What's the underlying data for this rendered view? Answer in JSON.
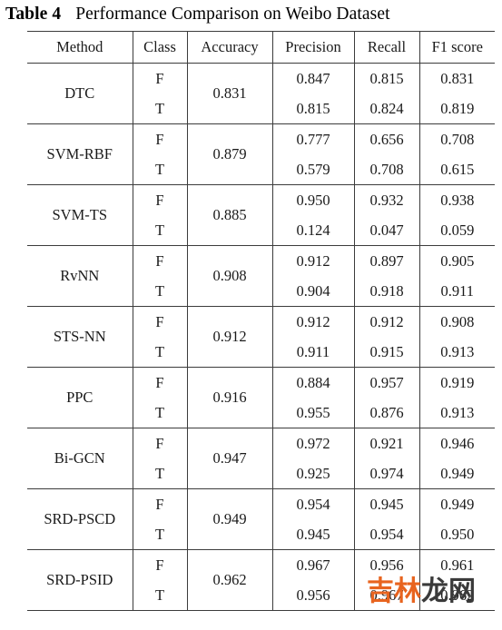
{
  "caption": {
    "label": "Table 4",
    "text": "Performance Comparison on Weibo Dataset"
  },
  "table": {
    "headers": [
      "Method",
      "Class",
      "Accuracy",
      "Precision",
      "Recall",
      "F1 score"
    ],
    "class_labels": {
      "f": "F",
      "t": "T"
    },
    "rows": [
      {
        "method": "DTC",
        "method_bold": false,
        "accuracy": "0.831",
        "accuracy_bold": false,
        "f": {
          "precision": "0.847",
          "recall": "0.815",
          "f1": "0.831",
          "precision_bold": false,
          "recall_bold": false,
          "f1_bold": false
        },
        "t": {
          "precision": "0.815",
          "recall": "0.824",
          "f1": "0.819",
          "precision_bold": false,
          "recall_bold": false,
          "f1_bold": false
        }
      },
      {
        "method": "SVM-RBF",
        "method_bold": false,
        "accuracy": "0.879",
        "accuracy_bold": false,
        "f": {
          "precision": "0.777",
          "recall": "0.656",
          "f1": "0.708",
          "precision_bold": false,
          "recall_bold": false,
          "f1_bold": false
        },
        "t": {
          "precision": "0.579",
          "recall": "0.708",
          "f1": "0.615",
          "precision_bold": false,
          "recall_bold": false,
          "f1_bold": false
        }
      },
      {
        "method": "SVM-TS",
        "method_bold": false,
        "accuracy": "0.885",
        "accuracy_bold": false,
        "f": {
          "precision": "0.950",
          "recall": "0.932",
          "f1": "0.938",
          "precision_bold": false,
          "recall_bold": false,
          "f1_bold": false
        },
        "t": {
          "precision": "0.124",
          "recall": "0.047",
          "f1": "0.059",
          "precision_bold": false,
          "recall_bold": false,
          "f1_bold": false
        }
      },
      {
        "method": "RvNN",
        "method_bold": false,
        "accuracy": "0.908",
        "accuracy_bold": false,
        "f": {
          "precision": "0.912",
          "recall": "0.897",
          "f1": "0.905",
          "precision_bold": false,
          "recall_bold": false,
          "f1_bold": false
        },
        "t": {
          "precision": "0.904",
          "recall": "0.918",
          "f1": "0.911",
          "precision_bold": false,
          "recall_bold": false,
          "f1_bold": false
        }
      },
      {
        "method": "STS-NN",
        "method_bold": false,
        "accuracy": "0.912",
        "accuracy_bold": false,
        "f": {
          "precision": "0.912",
          "recall": "0.912",
          "f1": "0.908",
          "precision_bold": false,
          "recall_bold": false,
          "f1_bold": false
        },
        "t": {
          "precision": "0.911",
          "recall": "0.915",
          "f1": "0.913",
          "precision_bold": false,
          "recall_bold": false,
          "f1_bold": false
        }
      },
      {
        "method": "PPC",
        "method_bold": false,
        "accuracy": "0.916",
        "accuracy_bold": false,
        "f": {
          "precision": "0.884",
          "recall": "0.957",
          "f1": "0.919",
          "precision_bold": false,
          "recall_bold": false,
          "f1_bold": false
        },
        "t": {
          "precision": "0.955",
          "recall": "0.876",
          "f1": "0.913",
          "precision_bold": false,
          "recall_bold": false,
          "f1_bold": false
        }
      },
      {
        "method": "Bi-GCN",
        "method_bold": false,
        "accuracy": "0.947",
        "accuracy_bold": false,
        "f": {
          "precision": "0.972",
          "recall": "0.921",
          "f1": "0.946",
          "precision_bold": true,
          "recall_bold": false,
          "f1_bold": false
        },
        "t": {
          "precision": "0.925",
          "recall": "0.974",
          "f1": "0.949",
          "precision_bold": false,
          "recall_bold": true,
          "f1_bold": false
        }
      },
      {
        "method": "SRD-PSCD",
        "method_bold": true,
        "accuracy": "0.949",
        "accuracy_bold": false,
        "f": {
          "precision": "0.954",
          "recall": "0.945",
          "f1": "0.949",
          "precision_bold": false,
          "recall_bold": false,
          "f1_bold": false
        },
        "t": {
          "precision": "0.945",
          "recall": "0.954",
          "f1": "0.950",
          "precision_bold": false,
          "recall_bold": false,
          "f1_bold": false
        }
      },
      {
        "method": "SRD-PSID",
        "method_bold": true,
        "accuracy": "0.962",
        "accuracy_bold": true,
        "f": {
          "precision": "0.967",
          "recall": "0.956",
          "f1": "0.961",
          "precision_bold": false,
          "recall_bold": true,
          "f1_bold": true
        },
        "t": {
          "precision": "0.956",
          "recall": "0.967",
          "f1": "0.962",
          "precision_bold": true,
          "recall_bold": false,
          "f1_bold": true
        }
      }
    ]
  },
  "watermark": {
    "part_orange": "吉林",
    "part_dark": "龙网",
    "color_orange": "#e8641f",
    "color_dark": "#3a3a3a"
  }
}
